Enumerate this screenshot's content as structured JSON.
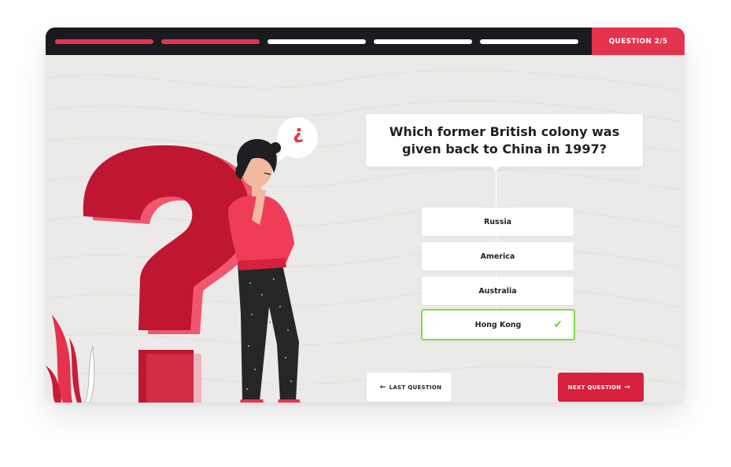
{
  "progress": {
    "segments": [
      "done",
      "done",
      "todo",
      "todo",
      "todo"
    ],
    "counter_label": "QUESTION 2/5"
  },
  "question": {
    "text": "Which former British colony was given back to China in 1997?"
  },
  "answers": [
    {
      "label": "Russia",
      "selected": false
    },
    {
      "label": "America",
      "selected": false
    },
    {
      "label": "Australia",
      "selected": false
    },
    {
      "label": "Hong Kong",
      "selected": true
    }
  ],
  "nav": {
    "prev_label": "LAST QUESTION",
    "next_label": "NEXT QUESTION",
    "prev_arrow": "←",
    "next_arrow": "→"
  },
  "illustration": {
    "speech_bubble_glyph": "¿",
    "big_glyph": "?"
  },
  "icons": {
    "check": "✔"
  },
  "colors": {
    "accent": "#e5334e",
    "accent_dark": "#d7203c",
    "correct": "#7fdc4a",
    "topbar": "#1b1b1f",
    "background": "#eceae8"
  }
}
